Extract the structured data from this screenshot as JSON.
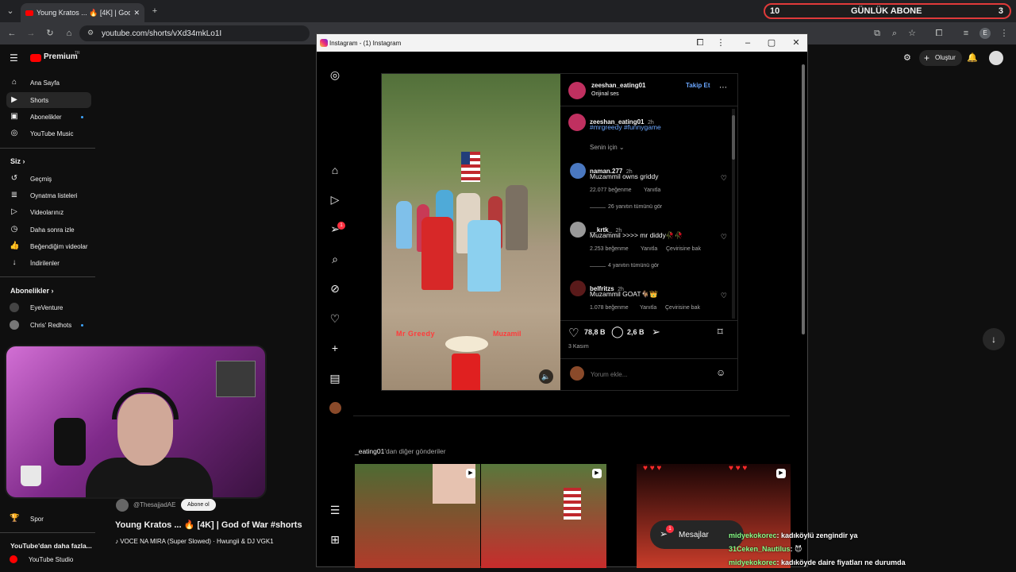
{
  "browser": {
    "tab_title": "Young Kratos ... 🔥 [4K] | God o",
    "url": "youtube.com/shorts/vXd34mkLo1I",
    "new_tab": "+"
  },
  "overlay": {
    "counter_left": "10",
    "counter_label": "GÜNLÜK ABONE",
    "counter_right": "3",
    "chat": [
      {
        "nick": "midyekokorec",
        "text": ": kadıköylü zengindir ya"
      },
      {
        "nick": "31Ceken_Nautilus",
        "text": ": 😈"
      },
      {
        "nick": "midyekokorec",
        "text": ": kadıköyde daire fiyatları ne durumda"
      }
    ]
  },
  "youtube": {
    "logo": "Premium",
    "logo_sup": "TR",
    "sidebar": {
      "items": [
        {
          "label": "Ana Sayfa",
          "icon": "home-icon"
        },
        {
          "label": "Shorts",
          "icon": "shorts-icon"
        },
        {
          "label": "Abonelikler",
          "icon": "subscriptions-icon"
        },
        {
          "label": "YouTube Music",
          "icon": "music-icon"
        }
      ],
      "you_header": "Siz",
      "you_items": [
        {
          "label": "Geçmiş"
        },
        {
          "label": "Oynatma listeleri"
        },
        {
          "label": "Videolarınız"
        },
        {
          "label": "Daha sonra izle"
        },
        {
          "label": "Beğendiğim videolar"
        },
        {
          "label": "İndirilenler"
        }
      ],
      "subs_header": "Abonelikler",
      "subs_items": [
        {
          "label": "EyeVenture"
        },
        {
          "label": "Chris' Redhots"
        }
      ],
      "spor": "Spor",
      "more_header": "YouTube'dan daha fazla...",
      "studio": "YouTube Studio"
    },
    "channel_name": "@ThesajjadAE",
    "subscribe_label": "Abone ol",
    "video_title": "Young Kratos ... 🔥 [4K] | God of War #shorts",
    "music": "♪ VOCE NA MIRA (Super Slowed) · Hwungii & DJ VGK1",
    "create_label": "Oluştur"
  },
  "instagram": {
    "window_title": "Instagram - (1) Instagram",
    "nav_badge": "1",
    "post": {
      "author": "zeeshan_eating01",
      "follow": "Takip Et",
      "audio": "Orijinal ses",
      "caption_user": "zeeshan_eating01",
      "caption_time": "2h",
      "caption_tags": "#mrgreedy #funnygame",
      "sort_label": "Senin için ⌄",
      "media_label_left": "Mr Greedy",
      "media_label_right": "Muzamil",
      "comments": [
        {
          "user": "naman.277",
          "time": "2h",
          "text": "Muzammil owns griddy",
          "likes": "22.077 beğenme",
          "reply": "Yanıtla",
          "translate": "",
          "view_replies": "26 yanıtın tümünü gör"
        },
        {
          "user": "__krtk_",
          "time": "2h",
          "text": "Muzammil >>>> mr diddy🥀🥀",
          "likes": "2.253 beğenme",
          "reply": "Yanıtla",
          "translate": "Çevirisine bak",
          "view_replies": "4 yanıtın tümünü gör"
        },
        {
          "user": "belfritzs",
          "time": "2h",
          "text": "Muzammil GOAT🐐👑",
          "likes": "1.078 beğenme",
          "reply": "Yanıtla",
          "translate": "Çevirisine bak",
          "view_replies": ""
        }
      ],
      "like_count": "78,8 B",
      "comment_count": "2,6 B",
      "date": "3 Kasım",
      "comment_placeholder": "Yorum ekle..."
    },
    "more_posts_prefix": "_eating01",
    "more_posts_suffix": "'dan diğer gönderiler",
    "messages_label": "Mesajlar",
    "messages_badge": "1"
  }
}
